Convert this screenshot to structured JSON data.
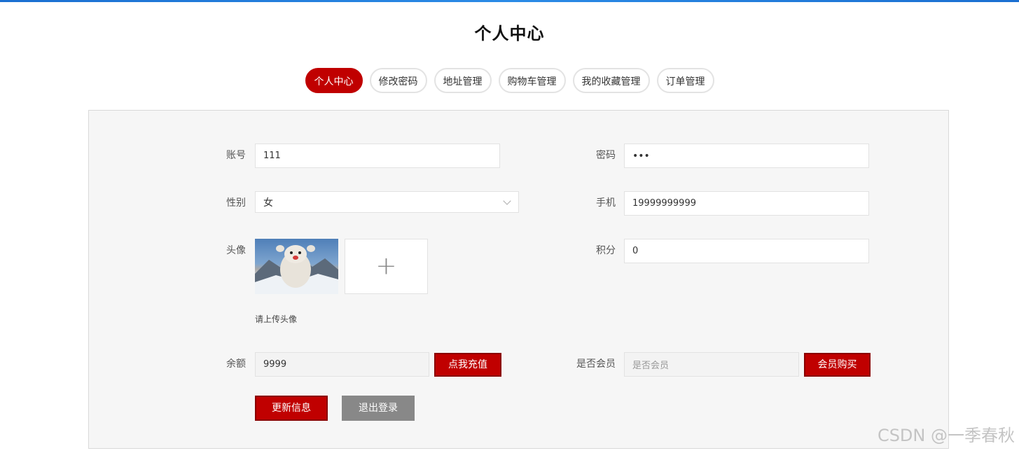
{
  "page": {
    "title": "个人中心"
  },
  "tabs": [
    {
      "label": "个人中心",
      "active": true
    },
    {
      "label": "修改密码",
      "active": false
    },
    {
      "label": "地址管理",
      "active": false
    },
    {
      "label": "购物车管理",
      "active": false
    },
    {
      "label": "我的收藏管理",
      "active": false
    },
    {
      "label": "订单管理",
      "active": false
    }
  ],
  "form": {
    "account": {
      "label": "账号",
      "value": "111"
    },
    "password": {
      "label": "密码",
      "value": "•••"
    },
    "gender": {
      "label": "性别",
      "value": "女"
    },
    "phone": {
      "label": "手机",
      "value": "19999999999"
    },
    "avatar": {
      "label": "头像",
      "hint": "请上传头像",
      "upload_icon": "plus-icon"
    },
    "points": {
      "label": "积分",
      "value": "0"
    },
    "balance": {
      "label": "余额",
      "value": "9999",
      "button": "点我充值"
    },
    "member": {
      "label": "是否会员",
      "placeholder": "是否会员",
      "button": "会员购买"
    }
  },
  "actions": {
    "update": "更新信息",
    "logout": "退出登录"
  },
  "watermark": "CSDN @一季春秋",
  "colors": {
    "accent": "#c00000",
    "panel_bg": "#f6f6f6",
    "secondary_button": "#888888",
    "top_bar": "#1b6fd1"
  }
}
